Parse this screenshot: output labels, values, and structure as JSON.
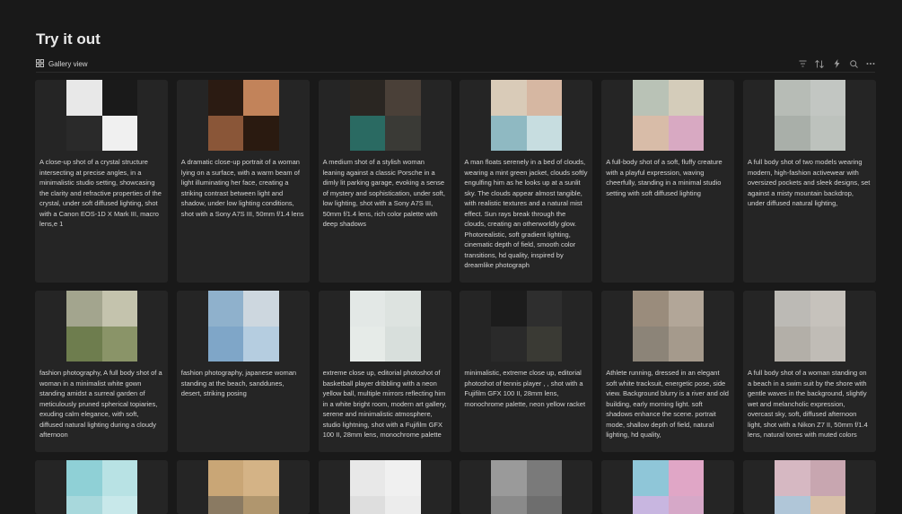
{
  "page": {
    "title": "Try it out"
  },
  "view": {
    "label": "Gallery view"
  },
  "toolbar": {
    "icons": [
      "filter-icon",
      "sort-icon",
      "lightning-icon",
      "search-icon",
      "more-icon"
    ]
  },
  "cards": [
    {
      "text": "A close-up shot of a crystal structure intersecting at precise angles, in a minimalistic studio setting, showcasing the clarity and refractive properties of the crystal, under soft diffused lighting, shot with a Canon EOS-1D X Mark III, macro lens,e 1",
      "colors": [
        "#e8e8e8",
        "#1a1a1a",
        "#2a2a2a",
        "#f0f0f0"
      ]
    },
    {
      "text": "A dramatic close-up portrait of a woman lying on a surface, with a warm beam of light illuminating her face, creating a striking contrast between light and shadow, under low lighting conditions, shot with a Sony A7S III, 50mm f/1.4 lens",
      "colors": [
        "#2b1b12",
        "#c2835a",
        "#8a5638",
        "#2a1a10"
      ]
    },
    {
      "text": "A medium shot of a stylish woman leaning against a classic Porsche in a dimly lit parking garage, evoking a sense of mystery and sophistication, under soft, low lighting, shot with a Sony A7S III, 50mm f/1.4 lens, rich color palette with deep shadows",
      "colors": [
        "#2a2622",
        "#4a4038",
        "#2a6a62",
        "#3a3a36"
      ]
    },
    {
      "text": "A man floats serenely in a bed of clouds, wearing a mint green jacket, clouds softly engulfing him as he looks up at a sunlit sky. The clouds appear almost tangible, with realistic textures and a natural mist effect. Sun rays break through the clouds, creating an otherworldly glow. Photorealistic, soft gradient lighting, cinematic depth of field, smooth color transitions, hd quality, inspired by dreamlike photograph",
      "colors": [
        "#d9cbb8",
        "#d6b7a2",
        "#8fb9c2",
        "#c7dde0"
      ]
    },
    {
      "text": "A full-body shot of a soft, fluffy creature with a playful expression, waving cheerfully, standing in a minimal studio setting with soft diffused lighting",
      "colors": [
        "#b9c2b6",
        "#d4ccba",
        "#d8bca8",
        "#d8a9c2"
      ]
    },
    {
      "text": "A full body shot of two models wearing modern, high-fashion activewear with oversized pockets and sleek designs, set against a misty mountain backdrop, under diffused natural lighting,",
      "colors": [
        "#b7bcb6",
        "#c2c6c2",
        "#a9afa9",
        "#bdc2bd"
      ]
    },
    {
      "text": "fashion photography, A full body shot of a woman in a minimalist white gown standing amidst a surreal garden of meticulously pruned spherical topiaries, exuding calm elegance, with soft, diffused natural lighting during a cloudy afternoon",
      "colors": [
        "#a3a58e",
        "#c4c3ad",
        "#6e7d4e",
        "#8a9468"
      ]
    },
    {
      "text": "fashion photography, japanese woman standing at the beach, sanddunes, desert, striking posing",
      "colors": [
        "#8fb1cc",
        "#cdd7df",
        "#7fa6c8",
        "#b5cde0"
      ]
    },
    {
      "text": "extreme close up, editorial photoshot of basketball player dribbling with a neon yellow ball, multiple mirrors reflecting him in a white bright room, modern art gallery, serene and minimalistic atmosphere, studio lightning, shot with a Fujifilm GFX 100 II, 28mm lens, monochrome palette",
      "colors": [
        "#e3e8e6",
        "#dde3e0",
        "#e6ebe8",
        "#d8dfdc"
      ]
    },
    {
      "text": "minimalistic, extreme close up, editorial photoshot of tennis player , , shot with a Fujifilm GFX 100 II, 28mm lens, monochrome palette, neon yellow racket",
      "colors": [
        "#1c1c1c",
        "#2e2e2e",
        "#2a2a2a",
        "#3a3a34"
      ]
    },
    {
      "text": "Athlete running, dressed in an elegant soft white tracksuit, energetic pose, side view. Background blurry is a river and old building, early morning light. soft shadows enhance the scene. portrait mode, shallow depth of field, natural lighting, hd quality,",
      "colors": [
        "#9a8c7c",
        "#b2a698",
        "#8c8478",
        "#a59a8c"
      ]
    },
    {
      "text": "A full body shot of a woman standing on a beach in a swim suit by the shore with gentle waves in the background, slightly wet and melancholic expression, overcast sky, soft, diffused afternoon light, shot with a Nikon Z7 II, 50mm f/1.4 lens, natural tones with muted colors",
      "colors": [
        "#bcbab5",
        "#c6c2bc",
        "#b3afa8",
        "#c0bcb6"
      ]
    },
    {
      "text": "",
      "colors": [
        "#8fd0d6",
        "#b8e2e4",
        "#a8d8dc",
        "#c8e8ea"
      ]
    },
    {
      "text": "",
      "colors": [
        "#c9a676",
        "#d4b386",
        "#8a7a62",
        "#b0966e"
      ]
    },
    {
      "text": "",
      "colors": [
        "#e8e8e8",
        "#f0f0f0",
        "#dedede",
        "#ececec"
      ]
    },
    {
      "text": "",
      "colors": [
        "#9a9a9a",
        "#7a7a7a",
        "#8a8a8a",
        "#6e6e6e"
      ]
    },
    {
      "text": "",
      "colors": [
        "#8fc6d8",
        "#e0a6c6",
        "#c8b6e0",
        "#d6a8c8"
      ]
    },
    {
      "text": "",
      "colors": [
        "#d6b8c2",
        "#c8a6b0",
        "#b0c6d8",
        "#d8c0a8"
      ]
    }
  ]
}
